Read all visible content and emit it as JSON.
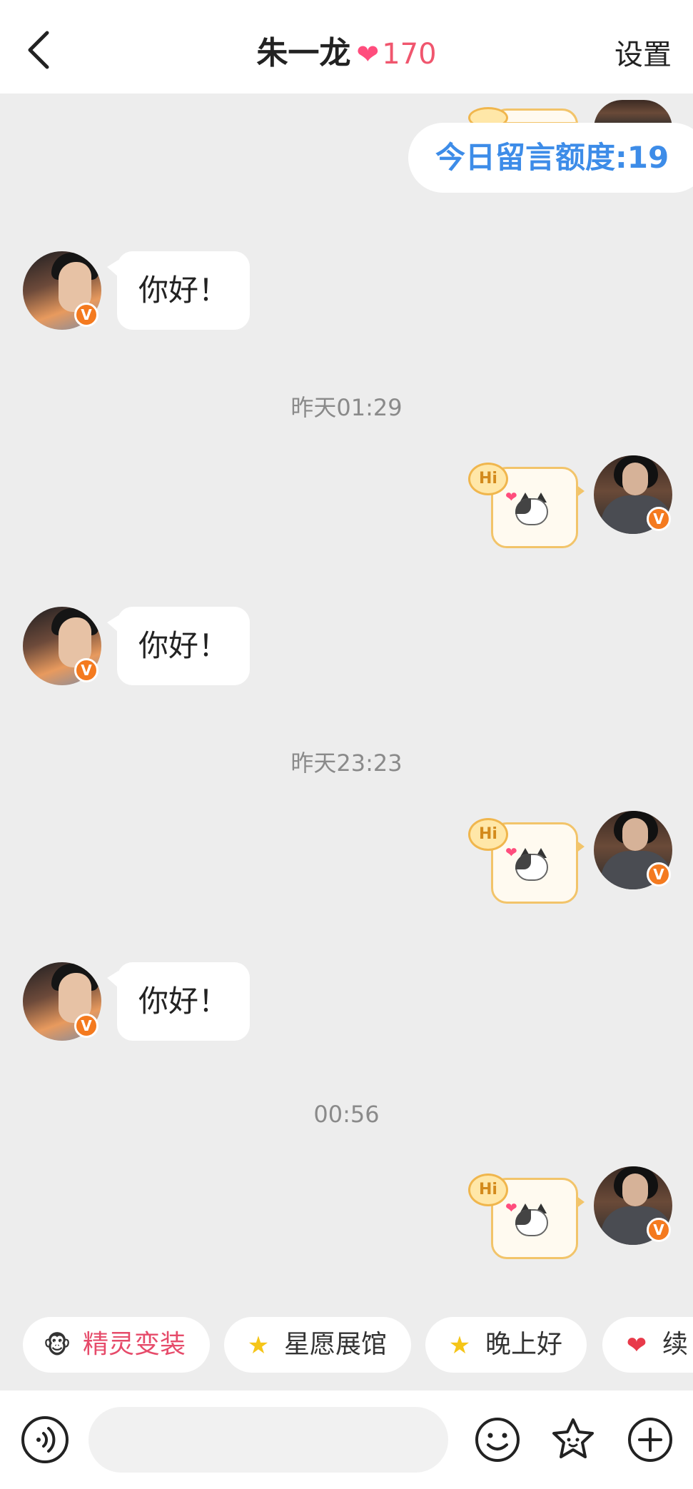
{
  "header": {
    "back_icon": "chevron-left-icon",
    "name": "朱一龙",
    "intimacy_icon": "heart-icon",
    "intimacy_value": "170",
    "settings_label": "设置"
  },
  "quota": {
    "label": "今日留言额度:19"
  },
  "messages": [
    {
      "side": "left",
      "text": "你好！"
    },
    {
      "time": "昨天01:29"
    },
    {
      "side": "right",
      "sticker_tag": "Hi"
    },
    {
      "side": "left",
      "text": "你好！"
    },
    {
      "time": "昨天23:23"
    },
    {
      "side": "right",
      "sticker_tag": "Hi"
    },
    {
      "side": "left",
      "text": "你好！"
    },
    {
      "time": "00:56"
    },
    {
      "side": "right",
      "sticker_tag": "Hi"
    }
  ],
  "quick_actions": [
    {
      "label": "精灵变装",
      "icon": "sprite-icon",
      "color": "#e64b6a"
    },
    {
      "label": "星愿展馆",
      "icon": "star-icon"
    },
    {
      "label": "晚上好",
      "icon": "smiling-star-icon"
    },
    {
      "label": "续",
      "icon": "heart-icon",
      "color": "#e83a4a"
    }
  ],
  "badge": {
    "verified_letter": "V",
    "color": "#f47a1f"
  },
  "footer": {
    "voice_icon": "voice-icon",
    "emoji_icon": "smiley-icon",
    "sticker_icon": "star-face-icon",
    "plus_icon": "plus-icon",
    "input_value": ""
  }
}
